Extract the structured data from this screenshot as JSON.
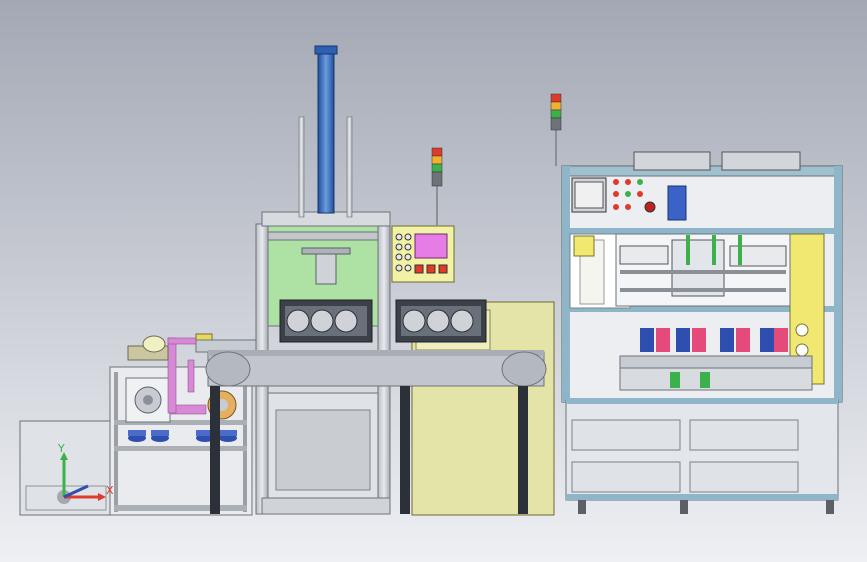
{
  "viewport": {
    "background_top": "#a3a8b4",
    "background_bottom": "#eef0f4"
  },
  "triad": {
    "x_label": "X",
    "y_label": "Y"
  },
  "colors": {
    "frame": "#d6d9de",
    "frame_dark": "#8a9096",
    "frame_blue": "#8fb6c8",
    "press_green": "#aee2a4",
    "cylinder_blue": "#3b73c7",
    "panel_yellow": "#f2f2a6",
    "cabinet_yellow": "#e4e4a8",
    "hmi_screen": "#e67ce6",
    "pipe_magenta": "#d68ad6",
    "conveyor": "#c2c6cc",
    "accent_blue": "#2e4fb0",
    "light_red": "#e03a2a",
    "light_amber": "#f0b030",
    "light_green": "#3cb04a"
  },
  "signal_towers": [
    {
      "name": "center-signal-tower"
    },
    {
      "name": "right-signal-tower"
    }
  ]
}
